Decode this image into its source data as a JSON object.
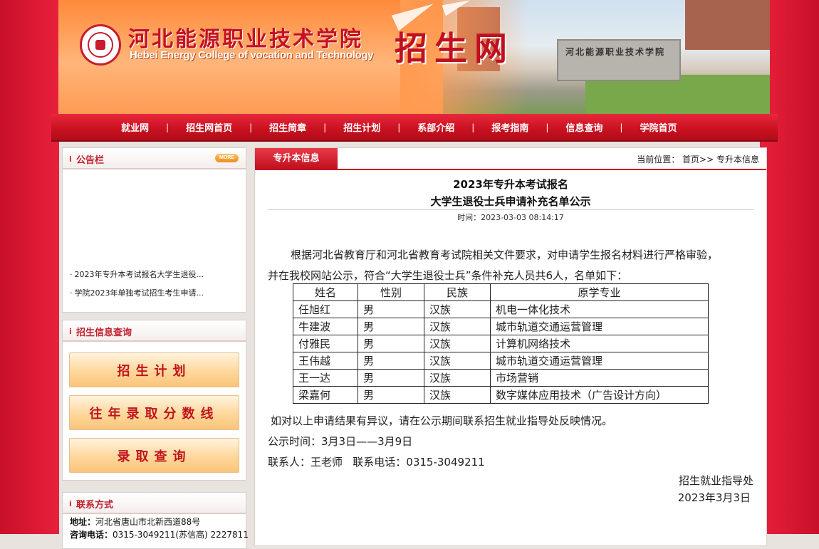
{
  "banner": {
    "college_cn": "河北能源职业技术学院",
    "college_en": "Hebei Energy College of vocation and Technology",
    "site_title": "招生网",
    "gate_text": "河北能源职业技术学院"
  },
  "nav": {
    "items": [
      "就业网",
      "招生网首页",
      "招生简章",
      "招生计划",
      "系部介绍",
      "报考指南",
      "信息查询",
      "学院首页"
    ]
  },
  "notice_board": {
    "title": "公告栏",
    "more_label": "MORE",
    "items": [
      "2023年专升本考试报名大学生退役...",
      "学院2023年单独考试招生考生申请..."
    ]
  },
  "query_panel": {
    "title": "招生信息查询",
    "buttons": [
      "招生计划",
      "往年录取分数线",
      "录取查询"
    ]
  },
  "contact_panel": {
    "title": "联系方式",
    "address_label": "地址：",
    "address": "河北省唐山市北新西道88号",
    "phone_label": "咨询电话：",
    "phone": "0315-3049211(苏信高) 2227811"
  },
  "main": {
    "tab_label": "专升本信息",
    "breadcrumb_prefix": "当前位置：",
    "breadcrumb_home": "首页",
    "breadcrumb_sep": ">>",
    "breadcrumb_current": "专升本信息",
    "title_line1": "2023年专升本考试报名",
    "title_line2": "大学生退役士兵申请补充名单公示",
    "publish_time": "时间：2023-03-03 08:14:17",
    "para1": "根据河北省教育厅和河北省教育考试院相关文件要求，对申请学生报名材料进行严格审验，",
    "para2": "并在我校网站公示，符合“大学生退役士兵”条件补充人员共6人，名单如下：",
    "table": {
      "headers": [
        "姓名",
        "性别",
        "民族",
        "原学专业"
      ],
      "rows": [
        [
          "任旭红",
          "男",
          "汉族",
          "机电一体化技术"
        ],
        [
          "牛建波",
          "男",
          "汉族",
          "城市轨道交通运营管理"
        ],
        [
          "付雅民",
          "男",
          "汉族",
          "计算机网络技术"
        ],
        [
          "王伟越",
          "男",
          "汉族",
          "城市轨道交通运营管理"
        ],
        [
          "王一达",
          "男",
          "汉族",
          "市场营销"
        ],
        [
          "梁嘉何",
          "男",
          "汉族",
          "数字媒体应用技术（广告设计方向）"
        ]
      ]
    },
    "objection": "如对以上申请结果有异议，请在公示期间联系招生就业指导处反映情况。",
    "period": "公示时间：3月3日——3月9日",
    "contact": "联系人：王老师   联系电话：0315-3049211",
    "signature_dept": "招生就业指导处",
    "signature_date": "2023年3月3日"
  }
}
